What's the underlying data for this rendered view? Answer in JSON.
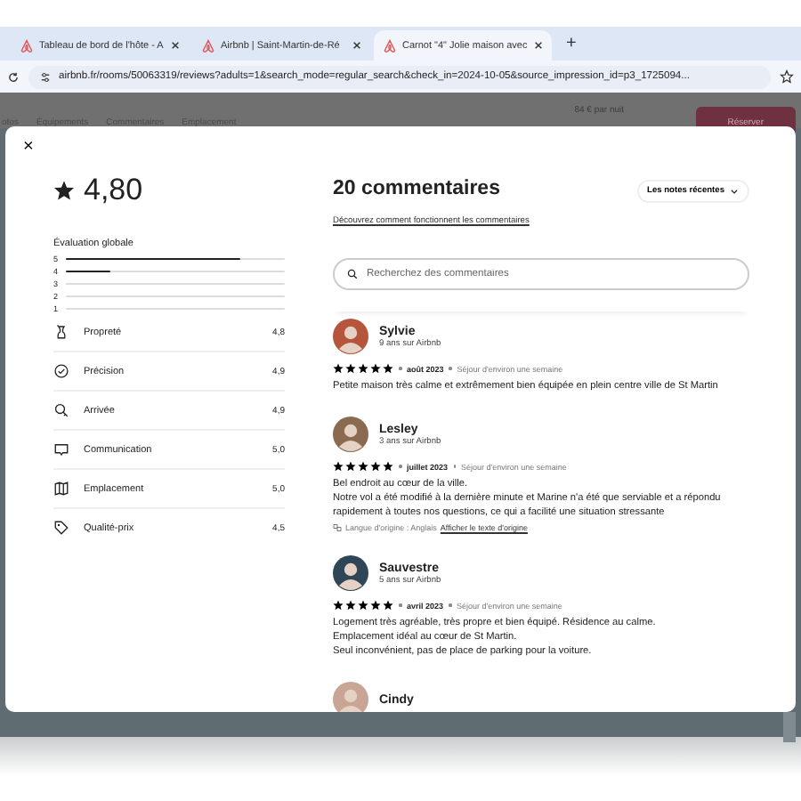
{
  "browser": {
    "tabs": [
      {
        "title": "Tableau de bord de l'hôte - A",
        "selected": false
      },
      {
        "title": "Airbnb | Saint-Martin-de-Ré",
        "selected": false
      },
      {
        "title": "Carnot \"4\" Jolie maison avec",
        "selected": true
      }
    ],
    "new_tab": "+",
    "url": "airbnb.fr/rooms/50063319/reviews?adults=1&search_mode=regular_search&check_in=2024-10-05&source_impression_id=p3_1725094..."
  },
  "page": {
    "nav": [
      "otos",
      "Équipements",
      "Commentaires",
      "Emplacement"
    ],
    "price": "84 € par nuit",
    "book_button": "Réserver"
  },
  "modal": {
    "close": "×",
    "rating": "4,80",
    "overall_label": "Évaluation globale",
    "distribution": [
      {
        "label": "5",
        "level": 0.8
      },
      {
        "label": "4",
        "level": 0.2
      },
      {
        "label": "3"
      },
      {
        "label": "2"
      },
      {
        "label": "1"
      }
    ],
    "categories": [
      {
        "name": "Propreté",
        "score": "4,8"
      },
      {
        "name": "Précision",
        "score": "4,9"
      },
      {
        "name": "Arrivée",
        "score": "4,9"
      },
      {
        "name": "Communication",
        "score": "5,0"
      },
      {
        "name": "Emplacement",
        "score": "5,0"
      },
      {
        "name": "Qualité-prix",
        "score": "4,5"
      }
    ],
    "title": "20 commentaires",
    "learn_link": "Découvrez comment fonctionnent les commentaires",
    "sort": "Les notes récentes",
    "search": {
      "placeholder": "Recherchez des commentaires"
    },
    "reviews": [
      {
        "name": "Sylvie",
        "tenure": "9 ans sur Airbnb",
        "stars": 5,
        "date": "août 2023",
        "stay": "Séjour d'environ une semaine",
        "text": [
          "Petite maison très calme et extrêmement bien équipée en plein centre ville de St Martin"
        ]
      },
      {
        "name": "Lesley",
        "tenure": "3 ans sur Airbnb",
        "stars": 5,
        "date": "juillet 2023",
        "stay": "Séjour d'environ une semaine",
        "text": [
          "Bel endroit au cœur de la ville.",
          "Notre vol a été modifié à la dernière minute et Marine n'a été que serviable et a répondu rapidement à toutes nos questions, ce qui a facilité une situation stressante"
        ],
        "translation": "Langue d'origine : Anglais",
        "original_link": "Afficher le texte d'origine"
      },
      {
        "name": "Sauvestre",
        "tenure": "5 ans sur Airbnb",
        "stars": 5,
        "date": "avril 2023",
        "stay": "Séjour d'environ une semaine",
        "text": [
          "Logement très agréable, très propre et bien équipé. Résidence au calme.",
          "Emplacement idéal au cœur de St Martin.",
          "Seul inconvénient, pas de place de parking pour la voiture."
        ]
      },
      {
        "name": "Cindy"
      }
    ]
  }
}
